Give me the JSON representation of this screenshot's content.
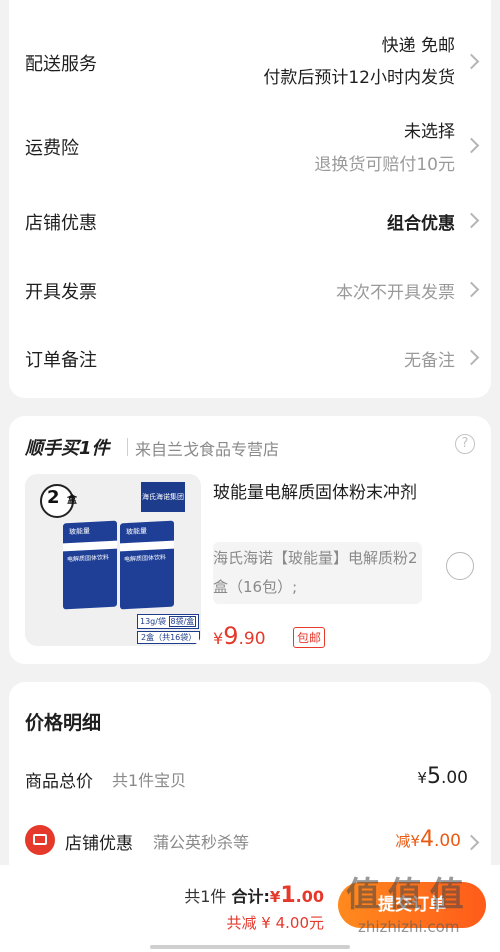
{
  "delivery": {
    "label": "配送服务",
    "line1": "快递 免邮",
    "line2": "付款后预计12小时内发货"
  },
  "insurance": {
    "label": "运费险",
    "line1": "未选择",
    "line2": "退换货可赔付10元"
  },
  "shop_discount": {
    "label": "店铺优惠",
    "value": "组合优惠"
  },
  "invoice": {
    "label": "开具发票",
    "value": "本次不开具发票"
  },
  "note": {
    "label": "订单备注",
    "value": "无备注"
  },
  "addon": {
    "title": "顺手买1件",
    "source": "来自兰戈食品专营店",
    "help_icon": "?",
    "product": {
      "name": "玻能量电解质固体粉末冲剂",
      "desc": "海氏海诺【玻能量】电解质粉2盒（16包）;",
      "price_symbol": "¥",
      "price_int": "9",
      "price_dec": ".90",
      "tag": "包邮",
      "img_badge_num": "2",
      "img_badge_unit": "盒",
      "img_brand": "海氏海诺集团",
      "img_spec1": "13g/袋",
      "img_spec2": "8袋/盒",
      "img_spec3": "2盒（共16袋）",
      "img_box_title": "电解质固体饮料",
      "img_box_brand": "玻能量"
    }
  },
  "price_detail": {
    "title": "价格明细",
    "goods_label": "商品总价",
    "goods_sub": "共1件宝贝",
    "goods_symbol": "¥",
    "goods_int": "5",
    "goods_dec": ".00",
    "shop_label": "店铺优惠",
    "shop_sub": "蒲公英秒杀等",
    "shop_prefix": "减",
    "shop_symbol": "¥",
    "shop_int": "4",
    "shop_dec": ".00"
  },
  "footer": {
    "count": "共1件",
    "total_label": "合计:",
    "total_symbol": "¥",
    "total_int": "1",
    "total_dec": ".00",
    "saved": "共减 ¥ 4.00元",
    "submit_label": "提交订单"
  },
  "watermark": {
    "main": "值 值 值",
    "sub": "zhizhizhi.com"
  },
  "colors": {
    "accent": "#e5392c",
    "orange": "#ea5a13",
    "submit": "#ff6a1a"
  }
}
